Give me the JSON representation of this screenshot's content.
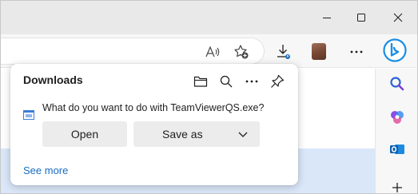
{
  "window": {
    "controls": {
      "minimize_icon": "minimize-icon",
      "maximize_icon": "maximize-icon",
      "close_icon": "close-icon"
    }
  },
  "toolbar": {
    "icons": [
      "read-aloud-icon",
      "add-favorite-icon",
      "downloads-icon",
      "profile-avatar",
      "more-icon",
      "bing-copilot-icon"
    ]
  },
  "sidebar": {
    "icons": [
      "search-icon",
      "copilot-icon",
      "outlook-icon",
      "add-icon"
    ]
  },
  "downloads": {
    "title": "Downloads",
    "header_icons": [
      "open-folder-icon",
      "search-icon",
      "more-options-icon",
      "pin-icon"
    ],
    "question": "What do you want to do with TeamViewerQS.exe?",
    "open_label": "Open",
    "saveas_label": "Save as",
    "see_more_label": "See more"
  },
  "colors": {
    "accent": "#1a6dc2",
    "titlebar": "#e9e9e9",
    "button_bg": "#ececec",
    "highlight": "#dae7f9"
  }
}
